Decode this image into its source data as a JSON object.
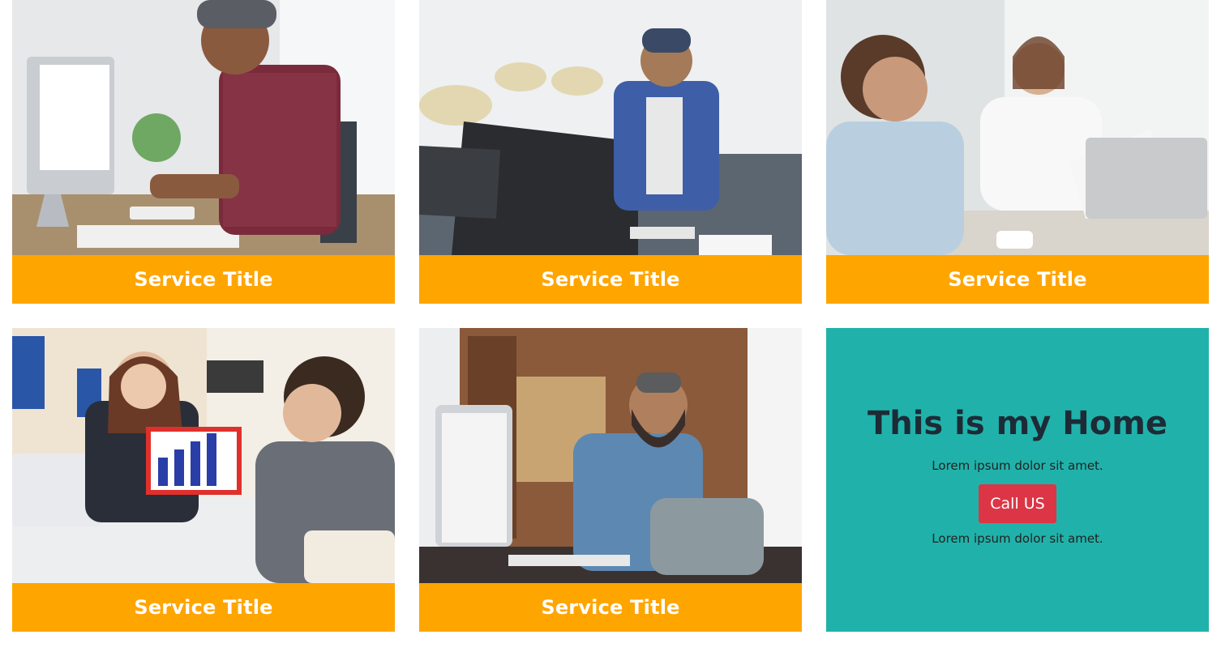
{
  "cards": [
    {
      "title": "Service Title",
      "image_alt": "man-typing-at-desktop-photo"
    },
    {
      "title": "Service Title",
      "image_alt": "man-at-office-computer-photo"
    },
    {
      "title": "Service Title",
      "image_alt": "business-meeting-photo"
    },
    {
      "title": "Service Title",
      "image_alt": "office-chart-presentation-photo"
    },
    {
      "title": "Service Title",
      "image_alt": "bearded-man-at-computer-photo"
    }
  ],
  "home": {
    "heading": "This is my Home",
    "text_top": "Lorem ipsum dolor sit amet.",
    "button_label": "Call US",
    "text_bottom": "Lorem ipsum dolor sit amet."
  },
  "colors": {
    "title_bar": "#ffa500",
    "home_bg": "#20b2aa",
    "button": "#dc3545"
  }
}
